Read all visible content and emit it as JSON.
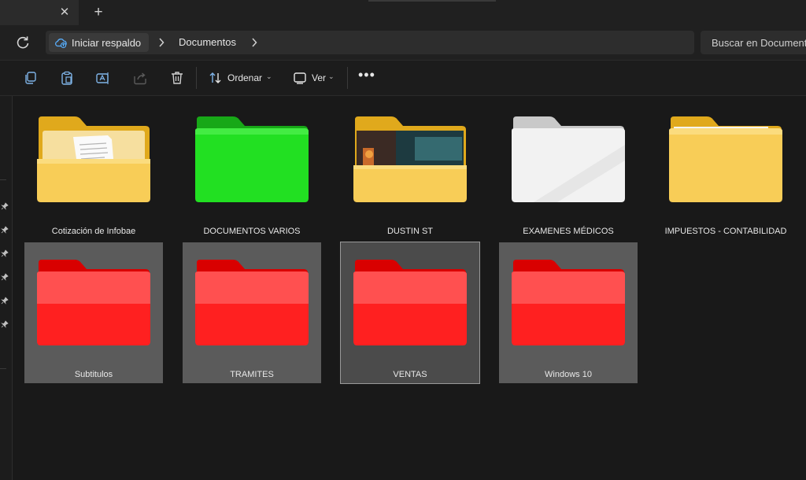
{
  "tabs": {
    "close_glyph": "✕",
    "new_glyph": "+"
  },
  "address": {
    "crumbs": [
      "Iniciar respaldo",
      "Documentos"
    ],
    "search_placeholder": "Buscar en Documentos"
  },
  "toolbar": {
    "sort_label": "Ordenar",
    "view_label": "Ver",
    "more_glyph": "•••"
  },
  "folders": [
    {
      "name": "Cotización de Infobae",
      "color": "#f3c44a",
      "preview": "document"
    },
    {
      "name": "DOCUMENTOS VARIOS",
      "color": "#22e022",
      "preview": "none"
    },
    {
      "name": "DUSTIN ST",
      "color": "#f3c44a",
      "preview": "photo"
    },
    {
      "name": "EXAMENES MÉDICOS",
      "color": "#f2f2f2",
      "preview": "none"
    },
    {
      "name": "IMPUESTOS - CONTABILIDAD",
      "color": "#f3c44a",
      "preview": "paper"
    },
    {
      "name": "Subtitulos",
      "color": "#ff1f1f",
      "preview": "none"
    },
    {
      "name": "TRAMITES",
      "color": "#ff1f1f",
      "preview": "none"
    },
    {
      "name": "VENTAS",
      "color": "#ff1f1f",
      "preview": "none",
      "selected": true
    },
    {
      "name": "Windows 10",
      "color": "#ff1f1f",
      "preview": "none"
    }
  ]
}
